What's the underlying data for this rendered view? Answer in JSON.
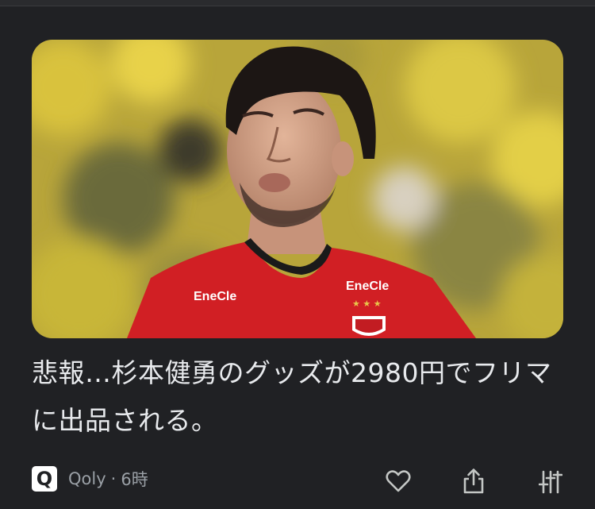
{
  "article": {
    "title": "悲報…杉本健勇のグッズが2980円でフリマに出品される。",
    "image": {
      "jersey_sponsor_left": "EneCle",
      "jersey_sponsor_right": "EneCle"
    }
  },
  "meta": {
    "source_logo": "Q",
    "source_name": "Qoly",
    "separator": "·",
    "time": "6時"
  },
  "actions": [
    {
      "name": "like",
      "icon": "heart-icon"
    },
    {
      "name": "share",
      "icon": "share-icon"
    },
    {
      "name": "more",
      "icon": "tune-icon"
    }
  ],
  "colors": {
    "background": "#202124",
    "text": "#e8eaed",
    "meta_text": "#9aa0a6"
  }
}
